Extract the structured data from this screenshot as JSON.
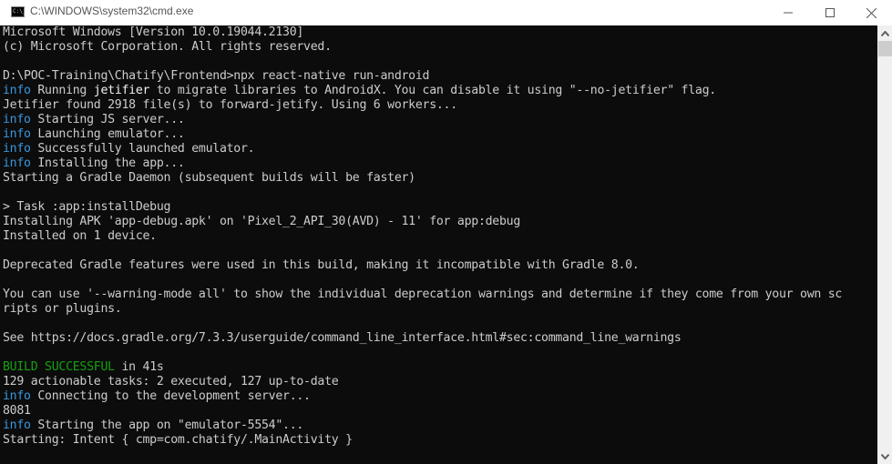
{
  "window": {
    "title": "C:\\WINDOWS\\system32\\cmd.exe",
    "icon_text": "C:\\_",
    "controls": [
      "minimize",
      "maximize",
      "close"
    ]
  },
  "colors": {
    "background": "#0c0c0c",
    "text": "#cccccc",
    "info": "#3a96dd",
    "bright": "#f2f2f2",
    "success": "#13a10e"
  },
  "console": {
    "lines": [
      [
        {
          "t": "Microsoft Windows [Version 10.0.19044.2130]"
        }
      ],
      [
        {
          "t": "(c) Microsoft Corporation. All rights reserved."
        }
      ],
      [
        {
          "t": ""
        }
      ],
      [
        {
          "t": "D:\\POC-Training\\Chatify\\Frontend>npx react-native run-android"
        }
      ],
      [
        {
          "t": "info",
          "c": "info"
        },
        {
          "t": " Running "
        },
        {
          "t": "jetifier",
          "c": "bright"
        },
        {
          "t": " to migrate libraries to AndroidX. You can disable it using \"--no-jetifier\" flag."
        }
      ],
      [
        {
          "t": "Jetifier found 2918 file(s) to forward-jetify. Using 6 workers..."
        }
      ],
      [
        {
          "t": "info",
          "c": "info"
        },
        {
          "t": " Starting JS server..."
        }
      ],
      [
        {
          "t": "info",
          "c": "info"
        },
        {
          "t": " Launching emulator..."
        }
      ],
      [
        {
          "t": "info",
          "c": "info"
        },
        {
          "t": " Successfully launched emulator."
        }
      ],
      [
        {
          "t": "info",
          "c": "info"
        },
        {
          "t": " Installing the app..."
        }
      ],
      [
        {
          "t": "Starting a Gradle Daemon (subsequent builds will be faster)"
        }
      ],
      [
        {
          "t": ""
        }
      ],
      [
        {
          "t": "> Task :app:installDebug"
        }
      ],
      [
        {
          "t": "Installing APK 'app-debug.apk' on 'Pixel_2_API_30(AVD) - 11' for app:debug"
        }
      ],
      [
        {
          "t": "Installed on 1 device."
        }
      ],
      [
        {
          "t": ""
        }
      ],
      [
        {
          "t": "Deprecated Gradle features were used in this build, making it incompatible with Gradle 8.0."
        }
      ],
      [
        {
          "t": ""
        }
      ],
      [
        {
          "t": "You can use '--warning-mode all' to show the individual deprecation warnings and determine if they come from your own sc"
        }
      ],
      [
        {
          "t": "ripts or plugins."
        }
      ],
      [
        {
          "t": ""
        }
      ],
      [
        {
          "t": "See https://docs.gradle.org/7.3.3/userguide/command_line_interface.html#sec:command_line_warnings"
        }
      ],
      [
        {
          "t": ""
        }
      ],
      [
        {
          "t": "BUILD SUCCESSFUL",
          "c": "green"
        },
        {
          "t": " in 41s"
        }
      ],
      [
        {
          "t": "129 actionable tasks: 2 executed, 127 up-to-date"
        }
      ],
      [
        {
          "t": "info",
          "c": "info"
        },
        {
          "t": " Connecting to the development server..."
        }
      ],
      [
        {
          "t": "8081"
        }
      ],
      [
        {
          "t": "info",
          "c": "info"
        },
        {
          "t": " Starting the app on \"emulator-5554\"..."
        }
      ],
      [
        {
          "t": "Starting: Intent { cmp=com.chatify/.MainActivity }"
        }
      ]
    ]
  }
}
